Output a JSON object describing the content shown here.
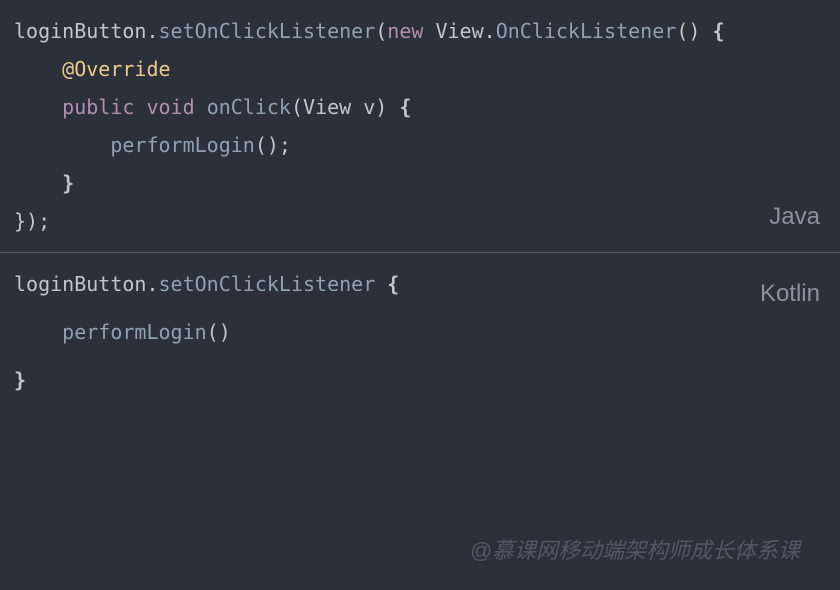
{
  "java": {
    "label": "Java",
    "line1": {
      "t1": "loginButton",
      "t2": ".",
      "t3": "setOnClickListener",
      "t4": "(",
      "t5": "new",
      "t6": " View",
      "t7": ".",
      "t8": "OnClickListener",
      "t9": "()",
      "t10": " {"
    },
    "line2": {
      "t1": "    ",
      "t2": "@Override"
    },
    "line3": {
      "t1": "    ",
      "t2": "public",
      "t3": " ",
      "t4": "void",
      "t5": " ",
      "t6": "onClick",
      "t7": "(",
      "t8": "View v",
      "t9": ")",
      "t10": " {"
    },
    "line4": {
      "t1": "        ",
      "t2": "performLogin",
      "t3": "();"
    },
    "line5": {
      "t1": "    ",
      "t2": "}"
    },
    "line6": {
      "t1": "});"
    }
  },
  "kotlin": {
    "label": "Kotlin",
    "line1": {
      "t1": "loginButton",
      "t2": ".",
      "t3": "setOnClickListener",
      "t4": " {"
    },
    "line2": {
      "t1": "    ",
      "t2": "performLogin",
      "t3": "()"
    },
    "line3": {
      "t1": "}"
    }
  },
  "watermark": "@慕课网移动端架构师成长体系课"
}
